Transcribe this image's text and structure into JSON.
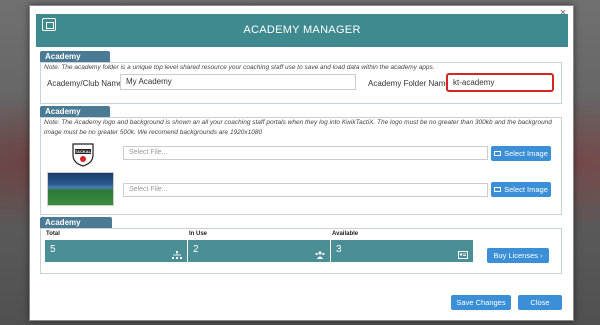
{
  "modal": {
    "title": "ACADEMY MANAGER",
    "close_glyph": "×"
  },
  "cloud": {
    "header": "Academy Cloud",
    "note": "Note: The academy folder is a unique top level shared resource your coaching staff use to save and load data within the academy apps.",
    "club_label": "Academy/Club Name:",
    "club_value": "My Academy",
    "folder_label": "Academy Folder Name:",
    "folder_value": "kt-academy"
  },
  "portal": {
    "header": "Academy Portal",
    "note": "Note: The Academy logo and background is shown an all your coaching staff portals when they log into KwikTactiX. The logo must be no greater than 300kb and the background image must be no greater 500k. We recomend backgrounds are 1920x1080",
    "logo_text": "TACKAL",
    "logo_file_placeholder": "Select File...",
    "bg_file_placeholder": "Select File...",
    "select_image_label": "Select Image"
  },
  "licenses": {
    "header": "Academy Licenses",
    "total_label": "Total",
    "total_value": "5",
    "inuse_label": "In Use",
    "inuse_value": "2",
    "available_label": "Available",
    "available_value": "3",
    "buy_label": "Buy Licenses ›"
  },
  "footer": {
    "save_label": "Save Changes",
    "close_label": "Close"
  },
  "colors": {
    "accent": "#3f8a8f",
    "section_header": "#4b7a95",
    "button": "#3b8fd6",
    "highlight": "#d42525"
  }
}
